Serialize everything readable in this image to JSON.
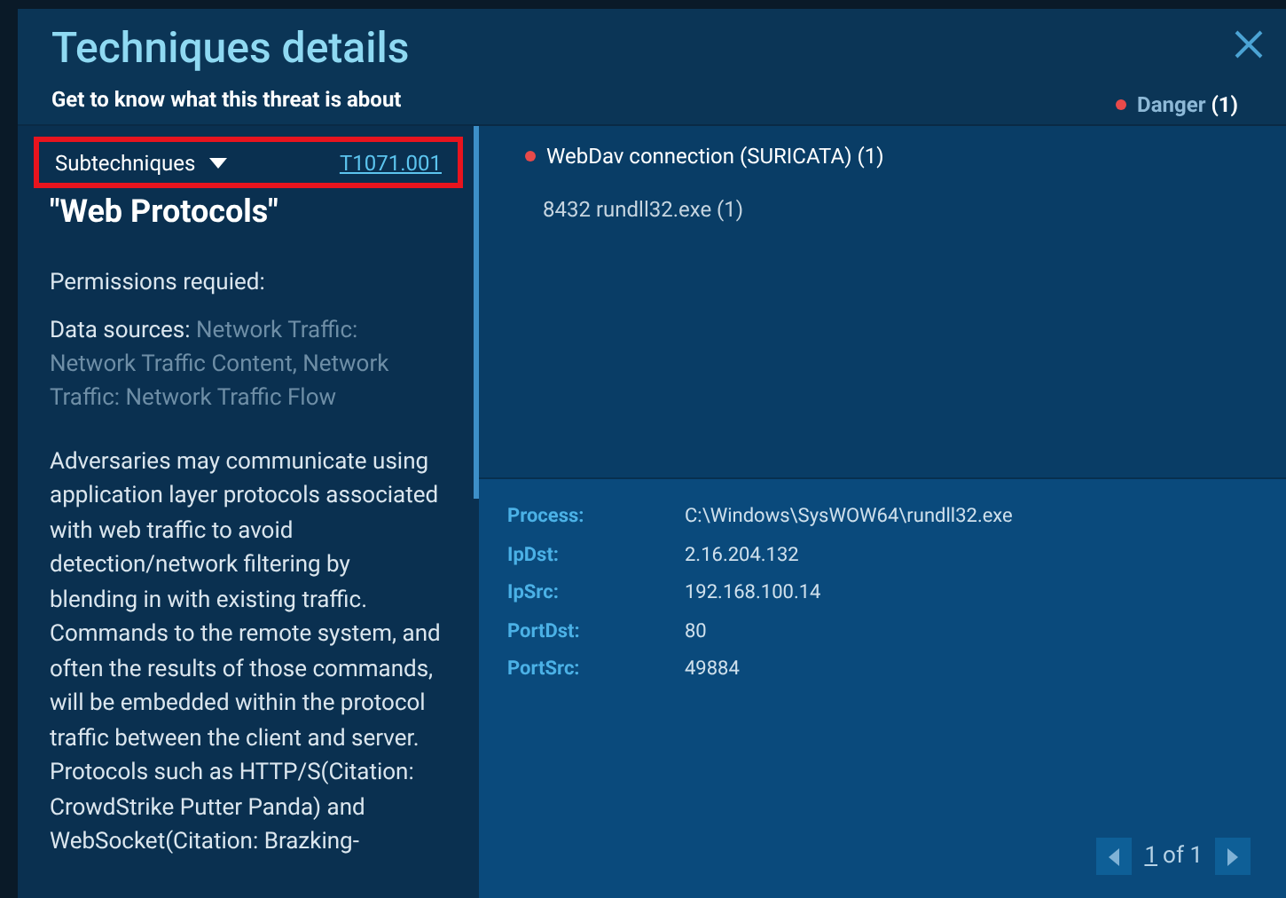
{
  "header": {
    "title": "Techniques details",
    "subtitle": "Get to know what this threat is about",
    "severity": {
      "label": "Danger",
      "count": "(1)",
      "color": "#e84a4a"
    }
  },
  "left_panel": {
    "subtechniques": {
      "label": "Subtechniques",
      "expanded": false,
      "highlighted": true
    },
    "technique_id": "T1071.001",
    "technique_name": "\"Web Protocols\"",
    "permissions_label": "Permissions requied:",
    "data_sources_label": "Data sources:",
    "data_sources": "Network Traffic: Network Traffic Content, Network Traffic: Network Traffic Flow",
    "description": [
      "Adversaries may communicate using application layer protocols associated with web traffic to avoid detection/network filtering by blending in with existing traffic. Commands to the remote system, and often the results of those commands, will be embedded within the protocol traffic between the client and server.",
      "Protocols such as HTTP/S(Citation: CrowdStrike Putter Panda) and WebSocket(Citation: Brazking-"
    ]
  },
  "alerts": [
    {
      "title": "WebDav connection (SURICATA) (1)",
      "color": "#e84a4a",
      "processes": [
        "8432 rundll32.exe (1)"
      ]
    }
  ],
  "details": [
    {
      "key": "Process:",
      "value": "C:\\Windows\\SysWOW64\\rundll32.exe"
    },
    {
      "key": "IpDst:",
      "value": "2.16.204.132"
    },
    {
      "key": "IpSrc:",
      "value": "192.168.100.14"
    },
    {
      "key": "PortDst:",
      "value": "80"
    },
    {
      "key": "PortSrc:",
      "value": "49884"
    }
  ],
  "pagination": {
    "page": "1",
    "total": "of 1",
    "prev_disabled": true,
    "next_disabled": true
  }
}
